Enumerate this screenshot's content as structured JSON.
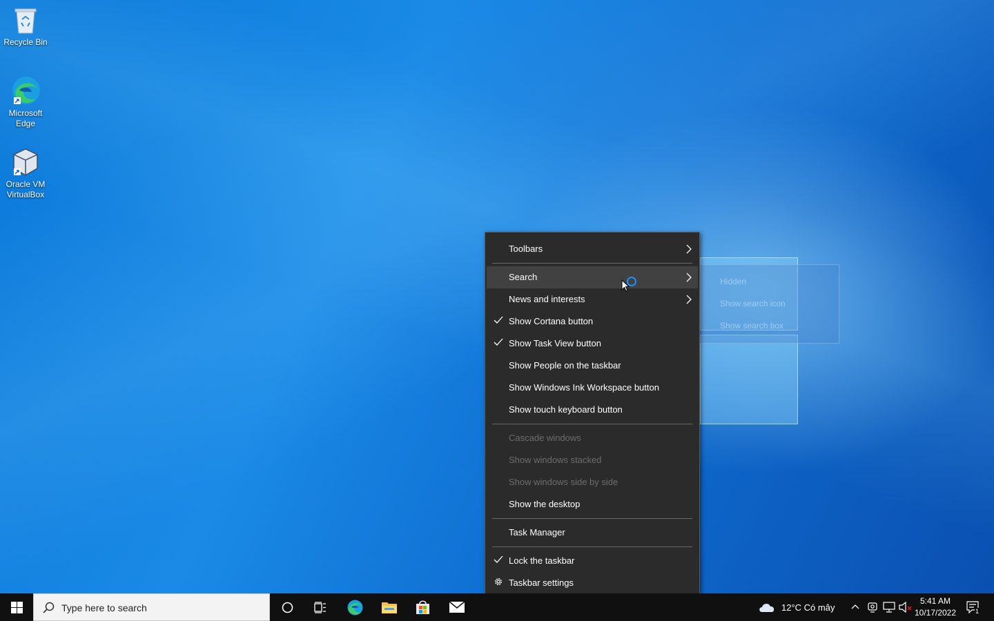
{
  "desktop": {
    "icons": [
      {
        "label": "Recycle Bin"
      },
      {
        "label": "Microsoft Edge"
      },
      {
        "label": "Oracle VM VirtualBox"
      }
    ]
  },
  "context_menu": {
    "items": {
      "toolbars": "Toolbars",
      "search": "Search",
      "news": "News and interests",
      "cortana": "Show Cortana button",
      "task_view": "Show Task View button",
      "people": "Show People on the taskbar",
      "ink": "Show Windows Ink Workspace button",
      "touch_kb": "Show touch keyboard button",
      "cascade": "Cascade windows",
      "stacked": "Show windows stacked",
      "side_by_side": "Show windows side by side",
      "desktop": "Show the desktop",
      "task_manager": "Task Manager",
      "lock": "Lock the taskbar",
      "settings": "Taskbar settings"
    },
    "checked": [
      "Show Cortana button",
      "Show Task View button",
      "Lock the taskbar"
    ]
  },
  "search_submenu": {
    "items": [
      "Hidden",
      "Show search icon",
      "Show search box"
    ]
  },
  "taskbar": {
    "search_placeholder": "Type here to search",
    "weather": "12°C  Có mây",
    "time": "5:41 AM",
    "date": "10/17/2022",
    "notification_count": "1"
  },
  "colors": {
    "menu_bg": "#2b2b2b",
    "accent": "#1e90ff",
    "taskbar_bg": "#101010"
  }
}
